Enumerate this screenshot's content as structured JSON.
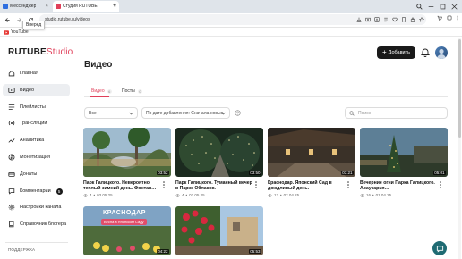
{
  "browser": {
    "tabs": [
      {
        "label": "Мессенджер",
        "active": false
      },
      {
        "label": "Студия RUTUBE",
        "active": true
      }
    ],
    "url": "studio.rutube.ru/videos",
    "tooltip": "Вперед",
    "bookmarks": [
      {
        "label": "YouTube"
      }
    ]
  },
  "app": {
    "logo_main": "RUTUBE",
    "logo_sub": "Studio",
    "brand_color": "#e0405a",
    "add_button": "Добавить",
    "page_title": "Видео"
  },
  "sidebar": {
    "items": [
      {
        "label": "Главная",
        "icon": "home-icon"
      },
      {
        "label": "Видео",
        "icon": "video-icon",
        "active": true
      },
      {
        "label": "Плейлисты",
        "icon": "playlist-icon"
      },
      {
        "label": "Трансляции",
        "icon": "broadcast-icon"
      },
      {
        "label": "Аналитика",
        "icon": "analytics-icon"
      },
      {
        "label": "Монетизация",
        "icon": "monetization-icon"
      },
      {
        "label": "Донаты",
        "icon": "donate-icon"
      },
      {
        "label": "Комментарии",
        "icon": "comment-icon",
        "badge": "5"
      },
      {
        "label": "Настройки канала",
        "icon": "settings-icon"
      },
      {
        "label": "Справочник блогера",
        "icon": "book-icon"
      }
    ],
    "support_label": "ПОДДЕРЖКА"
  },
  "content": {
    "tabs": [
      {
        "label": "Видео",
        "count": "6"
      },
      {
        "label": "Посты",
        "count": "0"
      }
    ],
    "filter": {
      "value": "Все"
    },
    "sort": {
      "value": "По дате добавления: Сначала новые"
    },
    "search": {
      "placeholder": "Поиск"
    },
    "videos": [
      {
        "title": "Парк Галицкого. Невероятно теплый зимний день. Фонтан…",
        "views": "4",
        "date": "03.05.25",
        "duration": "03:52",
        "overlay": ""
      },
      {
        "title": "Парк Галицкого. Туманный вечер в Парке Облаков.",
        "views": "4",
        "date": "02.05.25",
        "duration": "03:50",
        "overlay": ""
      },
      {
        "title": "Краснодар. Японский Сад в дождливый день.",
        "views": "13",
        "date": "02.04.25",
        "duration": "03:21",
        "overlay": ""
      },
      {
        "title": "Вечерние огни Парка Галицкого. Араукария…",
        "views": "16",
        "date": "01.04.25",
        "duration": "05:01",
        "overlay": ""
      },
      {
        "title": "",
        "views": "",
        "date": "",
        "duration": "04:22",
        "overlay": "КРАСНОДАР",
        "overlay2": "Весна в Японском Саду"
      },
      {
        "title": "",
        "views": "",
        "date": "",
        "duration": "05:53",
        "overlay": ""
      }
    ]
  }
}
